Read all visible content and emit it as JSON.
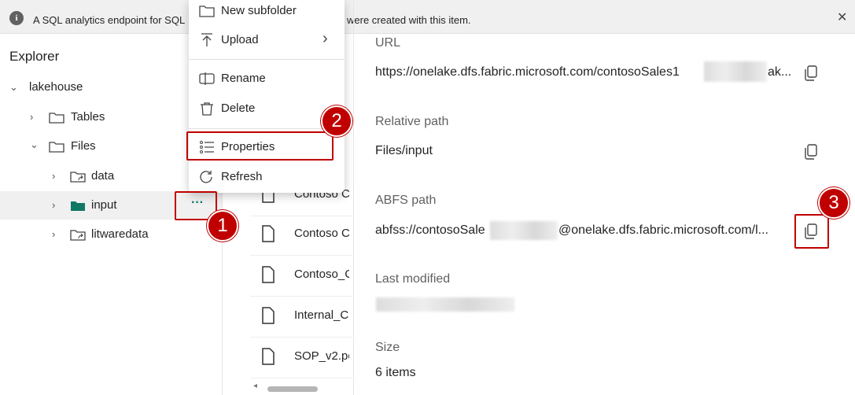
{
  "banner": {
    "text_left": "A SQL analytics endpoint for SQL",
    "text_right": "were created with this item.",
    "info_icon": "i",
    "close_icon": "✕"
  },
  "explorer": {
    "title": "Explorer",
    "tree": [
      {
        "label": "lakehouse",
        "level": 0,
        "expanded": true
      },
      {
        "label": "Tables",
        "level": 1,
        "expanded": false
      },
      {
        "label": "Files",
        "level": 1,
        "expanded": true
      },
      {
        "label": "data",
        "level": 2,
        "expanded": false
      },
      {
        "label": "input",
        "level": 2,
        "expanded": false,
        "selected": true
      },
      {
        "label": "litwaredata",
        "level": 2,
        "expanded": false
      }
    ],
    "more_label": "···"
  },
  "files": [
    {
      "label": "Contoso C"
    },
    {
      "label": "Contoso C"
    },
    {
      "label": "Contoso_C"
    },
    {
      "label": "Internal_C"
    },
    {
      "label": "SOP_v2.pc"
    }
  ],
  "context_menu": {
    "items": [
      {
        "label": "New subfolder",
        "icon": "folder-icon"
      },
      {
        "label": "Upload",
        "icon": "upload-icon",
        "submenu_chevron": "›"
      },
      {
        "label": "Rename",
        "icon": "rename-icon"
      },
      {
        "label": "Delete",
        "icon": "delete-icon"
      },
      {
        "label": "Properties",
        "icon": "properties-icon"
      },
      {
        "label": "Refresh",
        "icon": "refresh-icon"
      }
    ]
  },
  "properties": {
    "url_label": "URL",
    "url_value_start": "https://onelake.dfs.fabric.microsoft.com/contosoSales1",
    "url_value_end": "ak...",
    "relative_path_label": "Relative path",
    "relative_path_value": "Files/input",
    "abfs_label": "ABFS path",
    "abfs_value_start": "abfss://contosoSale",
    "abfs_value_end": "@onelake.dfs.fabric.microsoft.com/l...",
    "last_modified_label": "Last modified",
    "size_label": "Size",
    "size_value": "6 items"
  },
  "callouts": [
    "1",
    "2",
    "3"
  ],
  "colors": {
    "callout_red": "#c00000",
    "selected_folder": "#117865",
    "more_dots": "#117865"
  }
}
